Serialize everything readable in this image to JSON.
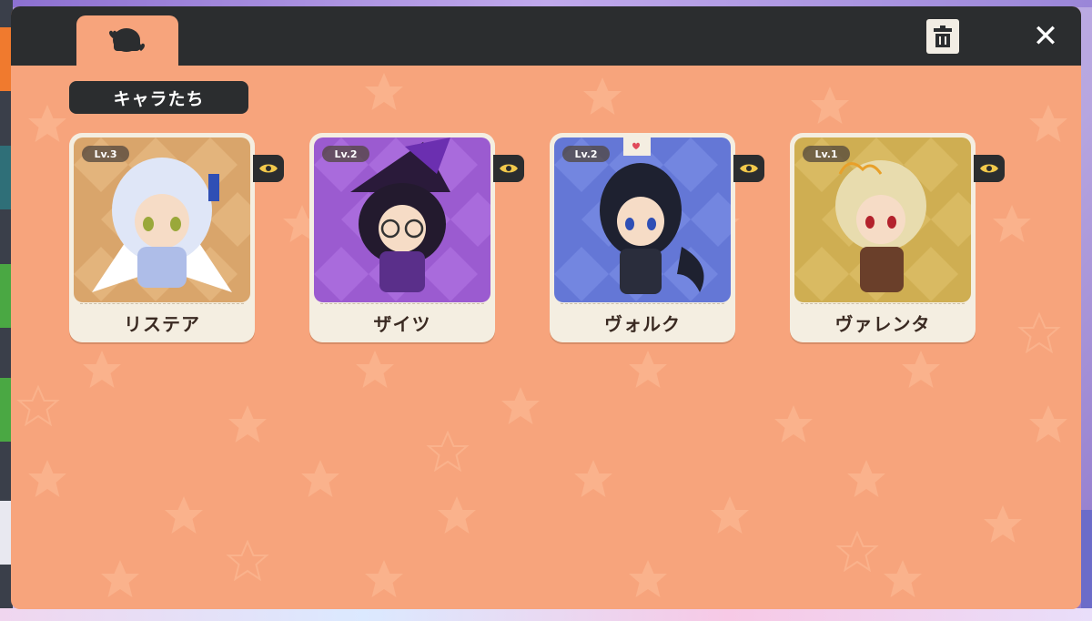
{
  "window": {
    "tab_icon": "character-silhouette-icon",
    "trash_icon": "trash-icon",
    "close_icon": "close-icon",
    "close_glyph": "✕",
    "bg_color": "#f7a47c",
    "titlebar_color": "#2b2d2f"
  },
  "section": {
    "title": "キャラたち"
  },
  "characters": [
    {
      "name": "リステア",
      "level": "Lv.3",
      "bg": "#d9a56b",
      "bg2": "#e3b47c",
      "eye_icon": "eye-icon"
    },
    {
      "name": "ザイツ",
      "level": "Lv.2",
      "bg": "#9b5bd0",
      "bg2": "#a96bdc",
      "eye_icon": "eye-icon"
    },
    {
      "name": "ヴォルク",
      "level": "Lv.2",
      "bg": "#6477d6",
      "bg2": "#7386e0",
      "eye_icon": "eye-icon"
    },
    {
      "name": "ヴァレンタ",
      "level": "Lv.1",
      "bg": "#cfae52",
      "bg2": "#d9ba62",
      "eye_icon": "eye-icon"
    }
  ]
}
